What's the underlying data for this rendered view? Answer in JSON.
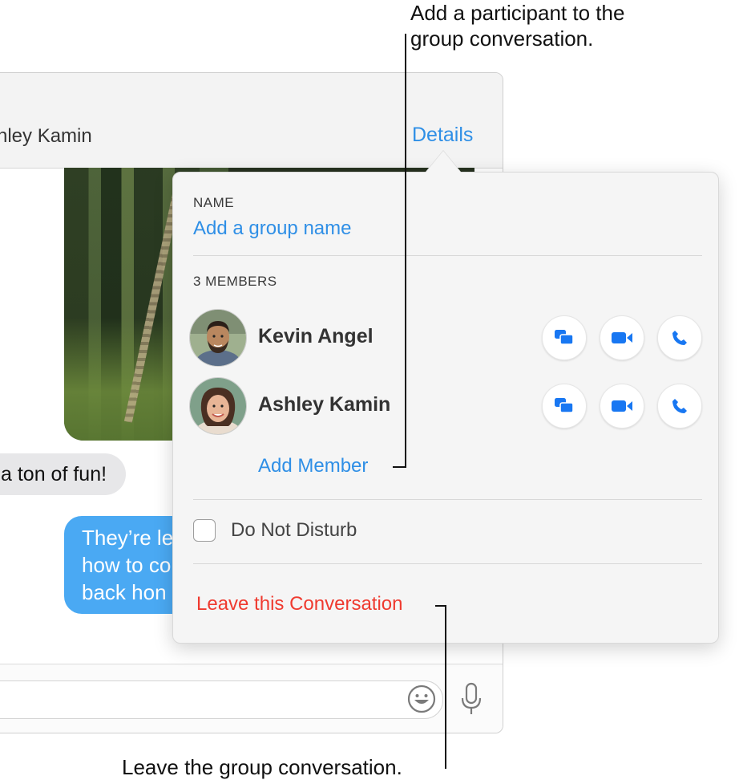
{
  "callouts": {
    "add_participant": [
      "Add a participant to the",
      "group conversation."
    ],
    "leave_group": "Leave the group conversation."
  },
  "window": {
    "conversation_title": "hley Kamin",
    "details_label": "Details"
  },
  "messages": {
    "incoming": "a ton of fun!",
    "outgoing_lines": [
      "They’re le",
      "how to co",
      "back hon"
    ]
  },
  "popover": {
    "name_section_label": "NAME",
    "group_name_placeholder": "Add a group name",
    "members_label": "3 MEMBERS",
    "members": [
      {
        "name": "Kevin Angel"
      },
      {
        "name": "Ashley Kamin"
      }
    ],
    "add_member_label": "Add Member",
    "do_not_disturb_label": "Do Not Disturb",
    "do_not_disturb_checked": false,
    "leave_label": "Leave this Conversation"
  },
  "colors": {
    "accent_blue": "#2f8fe6",
    "destructive_red": "#ef3a2f",
    "bubble_blue": "#4aa9f3",
    "bubble_gray": "#e7e7e9",
    "action_icon_blue": "#1877f2"
  },
  "icons": {
    "message": "message-icon",
    "video": "video-camera-icon",
    "phone": "phone-icon",
    "emoji": "emoji-icon",
    "mic": "microphone-icon"
  }
}
